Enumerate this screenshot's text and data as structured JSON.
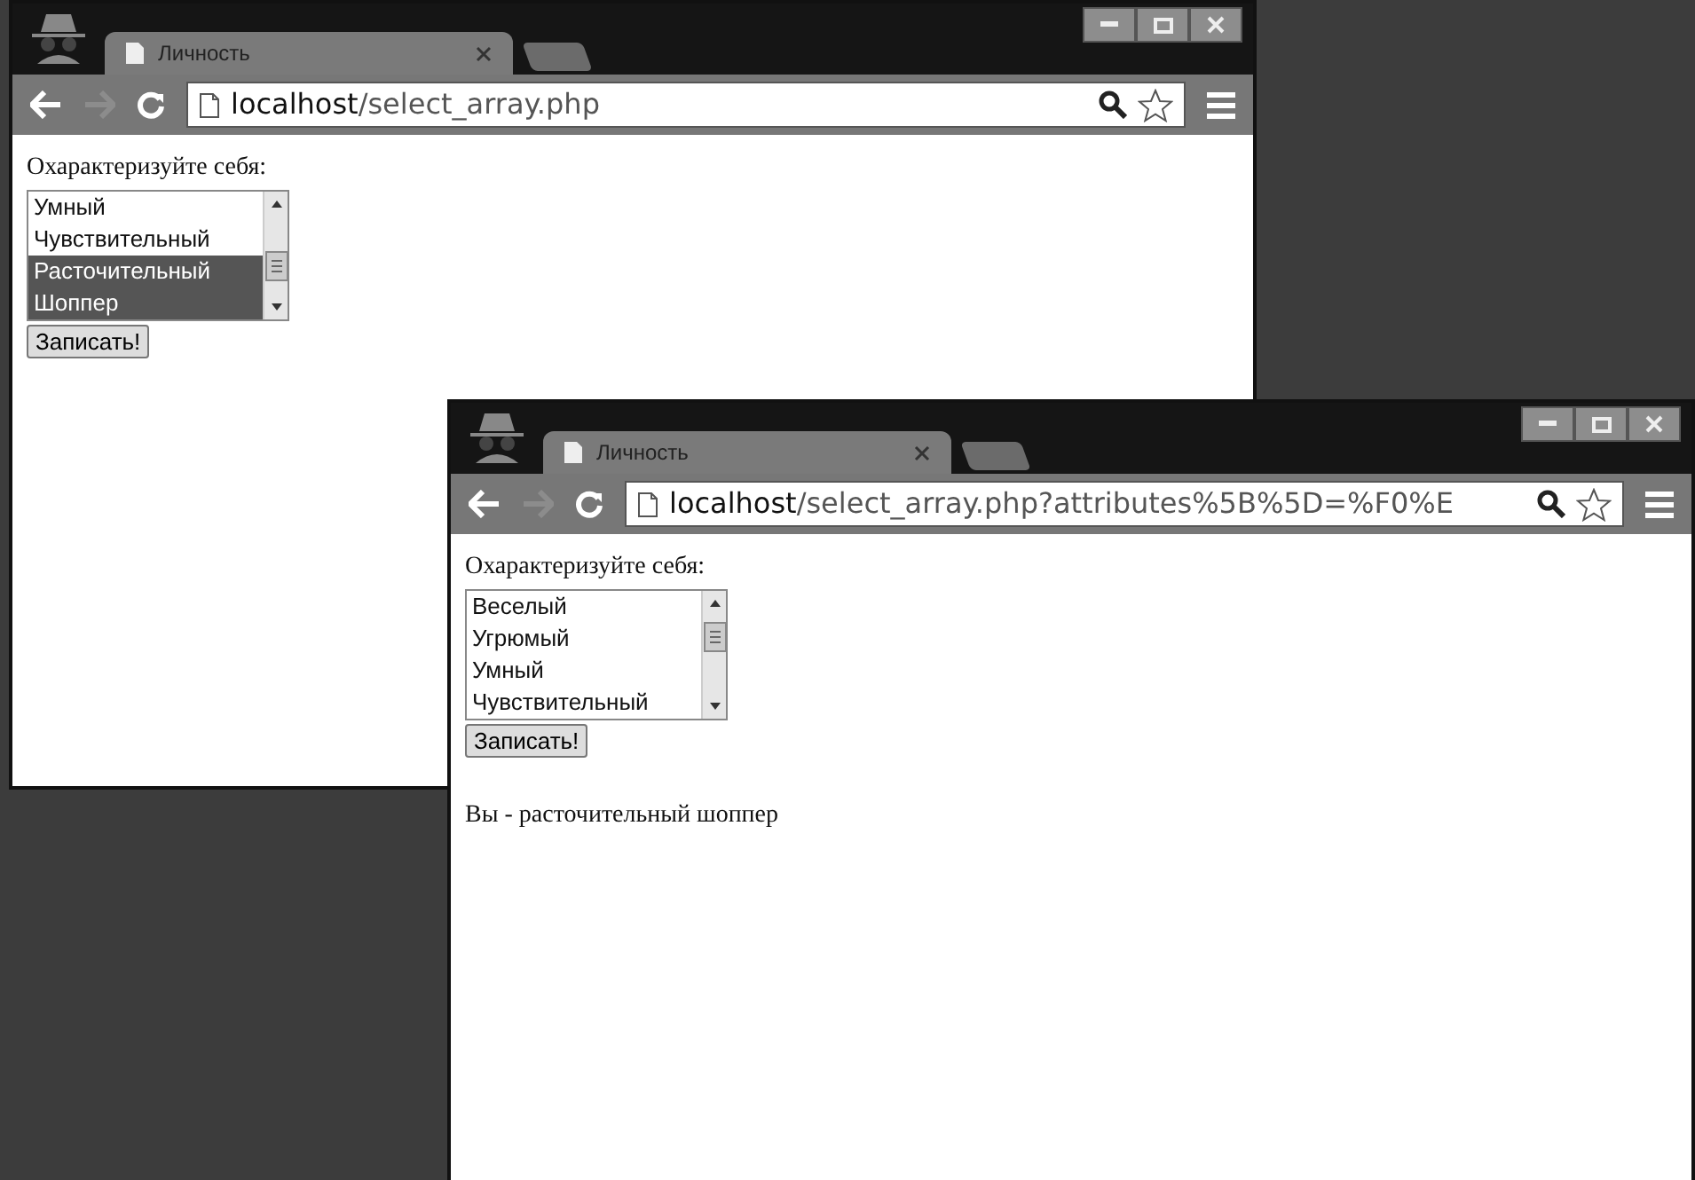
{
  "windows": [
    {
      "tab_title": "Личность",
      "url_host": "localhost",
      "url_path": "/select_array.php",
      "prompt": "Охарактеризуйте себя:",
      "options": [
        {
          "label": "Умный",
          "selected": false
        },
        {
          "label": "Чувствительный",
          "selected": false
        },
        {
          "label": "Расточительный",
          "selected": true
        },
        {
          "label": "Шоппер",
          "selected": true
        }
      ],
      "submit": "Записать!"
    },
    {
      "tab_title": "Личность",
      "url_host": "localhost",
      "url_path": "/select_array.php?attributes%5B%5D=%F0%E",
      "prompt": "Охарактеризуйте себя:",
      "options": [
        {
          "label": "Веселый",
          "selected": false
        },
        {
          "label": "Угрюмый",
          "selected": false
        },
        {
          "label": "Умный",
          "selected": false
        },
        {
          "label": "Чувствительный",
          "selected": false
        }
      ],
      "submit": "Записать!",
      "result": "Вы - расточительный шоппер"
    }
  ]
}
